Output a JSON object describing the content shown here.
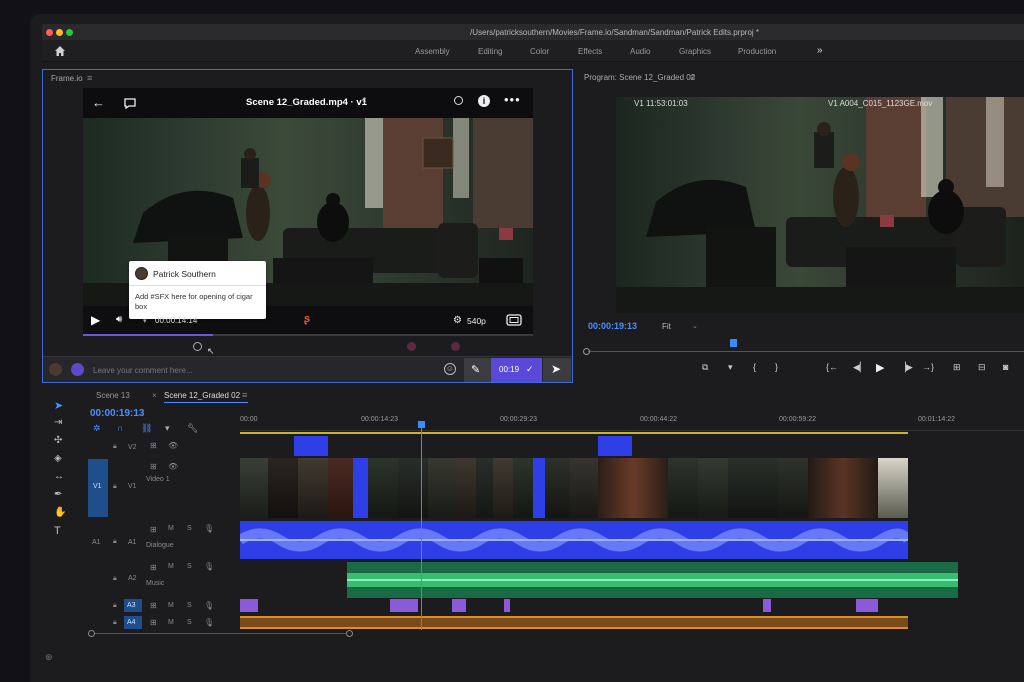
{
  "window": {
    "path": "/Users/patricksouthern/Movies/Frame.io/Sandman/Sandman/Patrick Edits.prproj *"
  },
  "workspaces": [
    "Assembly",
    "Editing",
    "Color",
    "Effects",
    "Audio",
    "Graphics",
    "Production"
  ],
  "frameio": {
    "panel_title": "Frame.io",
    "file_title": "Scene 12_Graded.mp4 · v1",
    "comment_author": "Patrick Southern",
    "comment_text": "Add #SFX here for opening of cigar box",
    "timecode": "00:00:14:14",
    "quality": "540p",
    "comment_placeholder": "Leave your comment here...",
    "comment_time": "00:19"
  },
  "program": {
    "panel_title": "Program: Scene 12_Graded 02",
    "overlay_left": "V1 11:53:01:03",
    "overlay_right": "V1 A004_C015_1123GE.mov",
    "timecode": "00:00:19:13",
    "fit": "Fit"
  },
  "timeline": {
    "tabs": [
      "Scene 13",
      "Scene 12_Graded 02"
    ],
    "timecode": "00:00:19:13",
    "ruler": [
      "00:00",
      "00:00:14:23",
      "00:00:29:23",
      "00:00:44:22",
      "00:00:59:22",
      "00:01:14:22"
    ],
    "tracks": {
      "v2": "V2",
      "v1": "V1",
      "video1": "Video 1",
      "a1": "A1",
      "dialogue": "Dialogue",
      "a2": "A2",
      "music": "Music",
      "a3": "A3",
      "a4": "A4"
    }
  },
  "colors": {
    "accent_blue": "#2f4fe8",
    "music_green": "#3ecb7a",
    "orange": "#e08a2a",
    "playhead": "#3b8bff"
  }
}
